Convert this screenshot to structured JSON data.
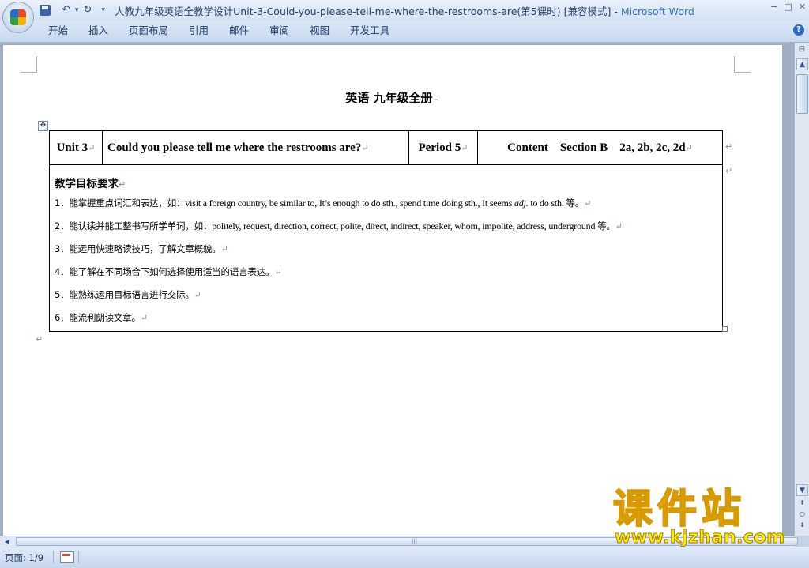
{
  "window": {
    "title_doc": "人教九年级英语全教学设计Unit-3-Could-you-please-tell-me-where-the-restrooms-are(第5课时) [兼容模式]",
    "title_sep": " - ",
    "title_app": "Microsoft Word",
    "controls": [
      "−",
      "□",
      "✕"
    ]
  },
  "qat": {
    "save": "save-icon",
    "undo": "↶",
    "undo_dd": "▾",
    "redo": "↻",
    "customize": "▾"
  },
  "ribbon": {
    "tabs": [
      "开始",
      "插入",
      "页面布局",
      "引用",
      "邮件",
      "审阅",
      "视图",
      "开发工具"
    ],
    "help": "?"
  },
  "document": {
    "heading": "英语  九年级全册",
    "para_mark": "↵",
    "table": {
      "header": {
        "unit": "Unit 3",
        "title": "Could you please tell me where the restrooms are?",
        "period": "Period 5",
        "content": "Content    Section B    2a, 2b, 2c, 2d"
      },
      "goals_title": "教学目标要求",
      "goals": [
        {
          "num": "1．",
          "zh": "能掌握重点词汇和表达，如：",
          "en": "visit a foreign country, be similar to, It’s enough to do sth., spend time doing sth., It seems ",
          "em": "adj.",
          "en2": " to do sth. ",
          "zh2": "等。"
        },
        {
          "num": "2．",
          "zh": "能认读并能工整书写所学单词，如：",
          "en": "politely, request, direction, correct, polite, direct, indirect, speaker, whom, impolite, address, underground ",
          "em": "",
          "en2": "",
          "zh2": "等。"
        },
        {
          "num": "3．",
          "zh": "能运用快速略读技巧，了解文章概貌。",
          "en": "",
          "em": "",
          "en2": "",
          "zh2": ""
        },
        {
          "num": "4．",
          "zh": "能了解在不同场合下如何选择使用适当的语言表达。",
          "en": "",
          "em": "",
          "en2": "",
          "zh2": ""
        },
        {
          "num": "5．",
          "zh": "能熟练运用目标语言进行交际。",
          "en": "",
          "em": "",
          "en2": "",
          "zh2": ""
        },
        {
          "num": "6．",
          "zh": "能流利朗读文章。",
          "en": "",
          "em": "",
          "en2": "",
          "zh2": ""
        }
      ]
    }
  },
  "scrollbar": {
    "up": "▲",
    "down": "▼",
    "prev": "⇞",
    "browse": "○",
    "next": "⇟",
    "left": "◀",
    "grip": "|||"
  },
  "status": {
    "page": "页面: 1/9"
  },
  "watermark": {
    "cn": "课件站",
    "url": "www.kjzhan.com"
  }
}
